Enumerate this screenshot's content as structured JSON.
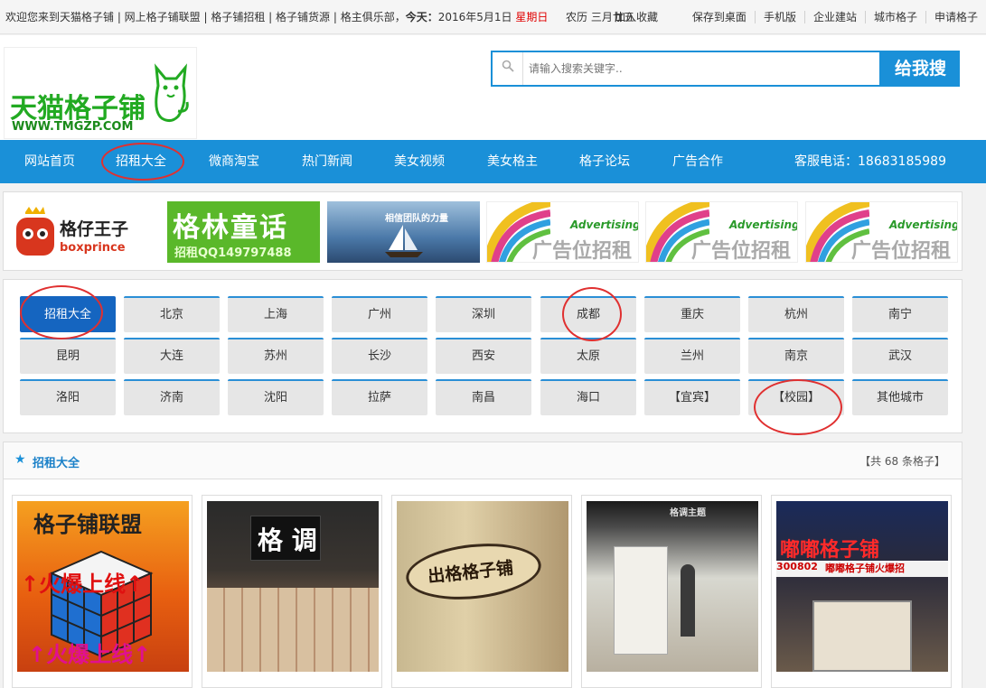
{
  "topbar": {
    "welcome": "欢迎您来到天猫格子铺 | 网上格子铺联盟 | 格子铺招租 | 格子铺货源 | 格主俱乐部，",
    "today_label": "今天：",
    "date": "2016年5月1日",
    "weekday": "星期日",
    "lunar": "农历 三月廿五",
    "add_favorite": "加入收藏",
    "links": [
      "保存到桌面",
      "手机版",
      "企业建站",
      "城市格子",
      "申请格子"
    ]
  },
  "header": {
    "logo_text": "天猫格子铺",
    "logo_url": "WWW.TMGZP.COM",
    "search_placeholder": "请输入搜索关键字..",
    "search_button": "给我搜"
  },
  "nav": {
    "items": [
      "网站首页",
      "招租大全",
      "微商淘宝",
      "热门新闻",
      "美女视频",
      "美女格主",
      "格子论坛",
      "广告合作"
    ],
    "phone": "客服电话：18683185989"
  },
  "ads": [
    {
      "line1": "格仔王子",
      "line2": "boxprince"
    },
    {
      "line1": "格林童话",
      "line2": "招租QQ149797488"
    },
    {
      "line1": "相信团队的力量",
      "line2": ""
    },
    {
      "line1": "Advertising",
      "line2": "广告位招租"
    },
    {
      "line1": "Advertising",
      "line2": "广告位招租"
    },
    {
      "line1": "Advertising",
      "line2": "广告位招租"
    }
  ],
  "cities": [
    [
      "招租大全",
      "北京",
      "上海",
      "广州",
      "深圳",
      "成都",
      "重庆",
      "杭州",
      "南宁"
    ],
    [
      "昆明",
      "大连",
      "苏州",
      "长沙",
      "西安",
      "太原",
      "兰州",
      "南京",
      "武汉"
    ],
    [
      "洛阳",
      "济南",
      "沈阳",
      "拉萨",
      "南昌",
      "海口",
      "【宜宾】",
      "【校园】",
      "其他城市"
    ]
  ],
  "listing": {
    "title": "招租大全",
    "count": "【共 68 条格子】",
    "cards": [
      {
        "caption1": "格子铺联盟",
        "caption2": "↑火爆上线↑",
        "caption3": "↑火爆上线↑"
      },
      {
        "caption1": "格 调",
        "caption2": "",
        "caption3": ""
      },
      {
        "caption1": "出格格子铺",
        "caption2": "",
        "caption3": ""
      },
      {
        "caption1": "格调主题",
        "caption2": "",
        "caption3": ""
      },
      {
        "caption1": "嘟嘟格子铺",
        "caption2": "300802",
        "caption3": "嘟嘟格子铺火爆招"
      }
    ]
  },
  "colors": {
    "brand_blue": "#1a90d8",
    "annotation_red": "#e03030",
    "logo_green": "#22aa22"
  }
}
